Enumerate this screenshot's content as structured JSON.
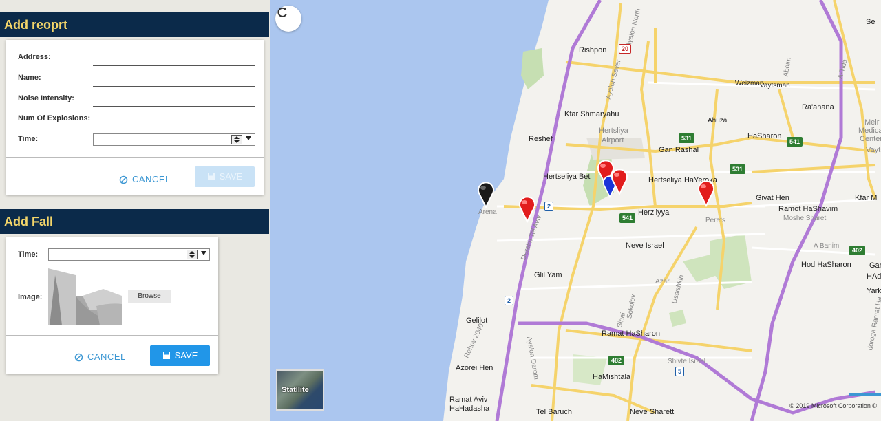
{
  "add_report": {
    "title": "Add reoprt",
    "fields": [
      {
        "label": "Address:",
        "value": ""
      },
      {
        "label": "Name:",
        "value": ""
      },
      {
        "label": "Noise Intensity:",
        "value": ""
      },
      {
        "label": "Num Of Explosions:",
        "value": ""
      }
    ],
    "time_label": "Time:",
    "time_value": "",
    "cancel_label": "CANCEL",
    "save_label": "SAVE"
  },
  "add_fall": {
    "title": "Add Fall",
    "time_label": "Time:",
    "time_value": "",
    "image_label": "Image:",
    "browse_label": "Browse",
    "cancel_label": "CANCEL",
    "save_label": "SAVE"
  },
  "map": {
    "satellite_label": "Statllite",
    "copyright": "© 2019 Microsoft Corporation  ©",
    "corner_text": "Se",
    "places": [
      "Rishpon",
      "Kfar Shmaryahu",
      "Hertsliya",
      "Airport",
      "Reshef",
      "Gan Rashal",
      "Hertseliya Bet",
      "Hertseliya HaYeroka",
      "Arena",
      "Herzliyya",
      "Perets",
      "Neve Israel",
      "Glil Yam",
      "Gelilot",
      "Ramat HaSharon",
      "HaMishtala",
      "Azorei Hen",
      "Ramat Aviv",
      "HaHadasha",
      "Tel Baruch",
      "Neve Sharett",
      "Weizman",
      "Vaytsman",
      "Ahuza",
      "HaSharon",
      "Ra'anana",
      "Meir",
      "Medical",
      "Center",
      "Vayts",
      "Givat Hen",
      "Ramot HaShavim",
      "Moshe Sharet",
      "Kfar M",
      "Hod HaSharon",
      "Gan",
      "HAda",
      "Yarko",
      "Abdim",
      "Ayalon Sever",
      "Ayalon North",
      "Derekh Tel Aviv",
      "Ayalon Darom",
      "Sokolov",
      "Shivte Israel",
      "Azar",
      "Ussishkin",
      "Sinai",
      "A Banim",
      "doroga Ramat Ha",
      "Rehov 2040",
      "A-Tida"
    ],
    "routes": [
      "20",
      "531",
      "531",
      "541",
      "541",
      "2",
      "2",
      "482",
      "5",
      "402"
    ]
  }
}
